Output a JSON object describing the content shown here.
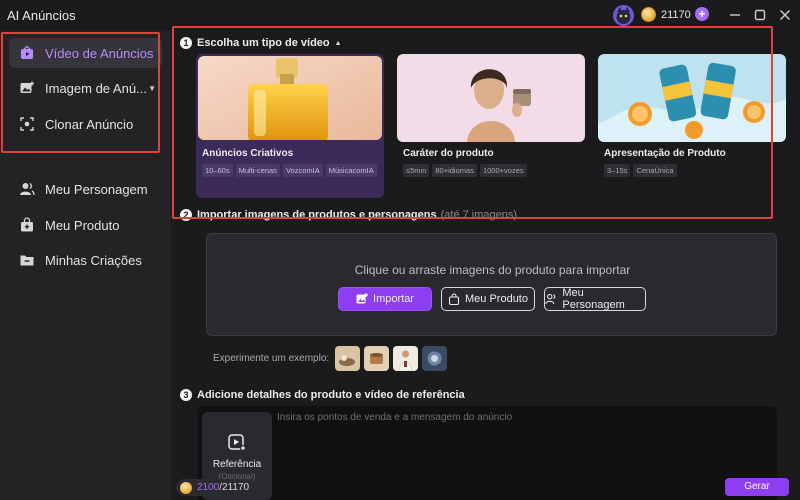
{
  "window": {
    "title": "AI Anúncios"
  },
  "header": {
    "coin_balance": "21170",
    "plus_label": "+"
  },
  "sidebar": {
    "items": [
      {
        "label": "Vídeo de Anúncios",
        "icon": "ad-video-icon"
      },
      {
        "label": "Imagem de Anú...",
        "icon": "ad-image-icon"
      },
      {
        "label": "Clonar Anúncio",
        "icon": "clone-icon"
      },
      {
        "label": "Meu Personagem",
        "icon": "person-icon"
      },
      {
        "label": "Meu Produto",
        "icon": "product-icon"
      },
      {
        "label": "Minhas Criações",
        "icon": "folder-icon"
      }
    ]
  },
  "section1": {
    "number": "1",
    "title": "Escolha um tipo de vídeo",
    "cards": [
      {
        "title": "Anúncios Criativos",
        "tags": [
          "10–60s",
          "Multi-cenas",
          "VozcomIA",
          "MúsicacomIA"
        ]
      },
      {
        "title": "Caráter do produto",
        "tags": [
          "≤5min",
          "80+idiomas",
          "1000+vozes"
        ]
      },
      {
        "title": "Apresentação de Produto",
        "tags": [
          "3–15s",
          "CenaÚnica"
        ]
      }
    ]
  },
  "section2": {
    "number": "2",
    "title": "Importar imagens de produtos e personagens",
    "hint": "(até 7 imagens)",
    "upload_text": "Clique ou arraste imagens do produto para importar",
    "import_label": "Importar",
    "product_label": "Meu Produto",
    "character_label": "Meu Personagem",
    "example_label": "Experimente um exemplo:"
  },
  "section3": {
    "number": "3",
    "title": "Adicione detalhes do produto e vídeo de referência",
    "reference_label": "Referência",
    "reference_sub": "(Opcional)",
    "placeholder": "Insira os pontos de venda e a mensagem do anúncio"
  },
  "footer": {
    "used": "2100",
    "total": "/21170",
    "generate_label": "Gerar"
  },
  "colors": {
    "accent": "#8d3ef0",
    "highlight": "#d9443b",
    "background": "#1b1b1d"
  }
}
